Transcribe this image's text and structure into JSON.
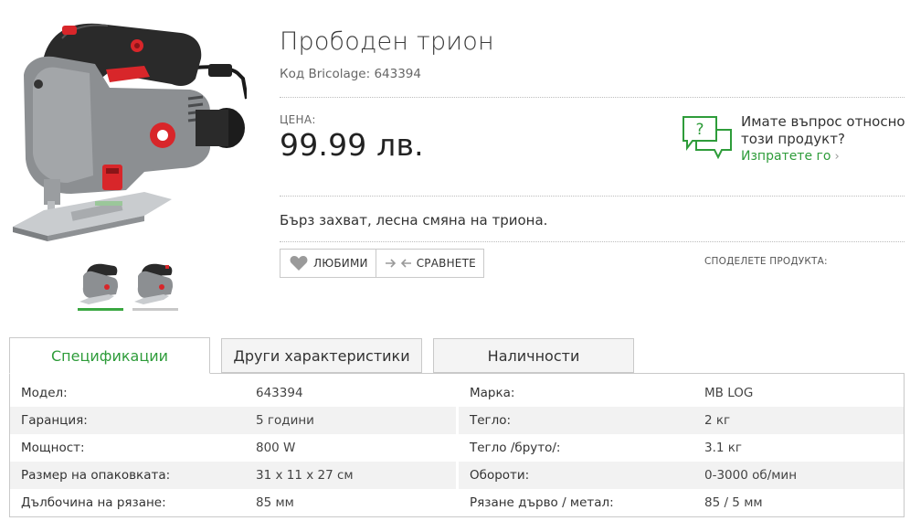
{
  "product": {
    "title": "Прободен трион",
    "code": "Код Bricolage: 643394",
    "price_label": "ЦЕНА:",
    "price": "99.99 лв.",
    "description": "Бърз захват, лесна смяна на триона."
  },
  "question": {
    "text": "Имате въпрос относно този продукт?",
    "link": "Изпратете го"
  },
  "actions": {
    "favorite": "ЛЮБИМИ",
    "compare": "СРАВНЕТЕ",
    "share": "СПОДЕЛЕТЕ ПРОДУКТА:"
  },
  "colors": {
    "accent": "#2e9c3a",
    "brand_red": "#e0262b"
  },
  "tabs": [
    {
      "label": "Спецификации",
      "active": true
    },
    {
      "label": "Други характеристики",
      "active": false
    },
    {
      "label": "Наличности",
      "active": false
    }
  ],
  "specs_left": [
    {
      "key": "Модел:",
      "value": "643394"
    },
    {
      "key": "Гаранция:",
      "value": "5 години"
    },
    {
      "key": "Мощност:",
      "value": "800 W"
    },
    {
      "key": "Размер на опаковката:",
      "value": "31 x 11 x 27 см"
    },
    {
      "key": "Дълбочина на рязане:",
      "value": "85 мм"
    }
  ],
  "specs_right": [
    {
      "key": "Марка:",
      "value": "MB LOG"
    },
    {
      "key": "Тегло:",
      "value": "2 кг"
    },
    {
      "key": "Тегло /бруто/:",
      "value": "3.1 кг"
    },
    {
      "key": "Обороти:",
      "value": "0-3000 об/мин"
    },
    {
      "key": "Рязане дърво / метал:",
      "value": "85 / 5 мм"
    }
  ]
}
